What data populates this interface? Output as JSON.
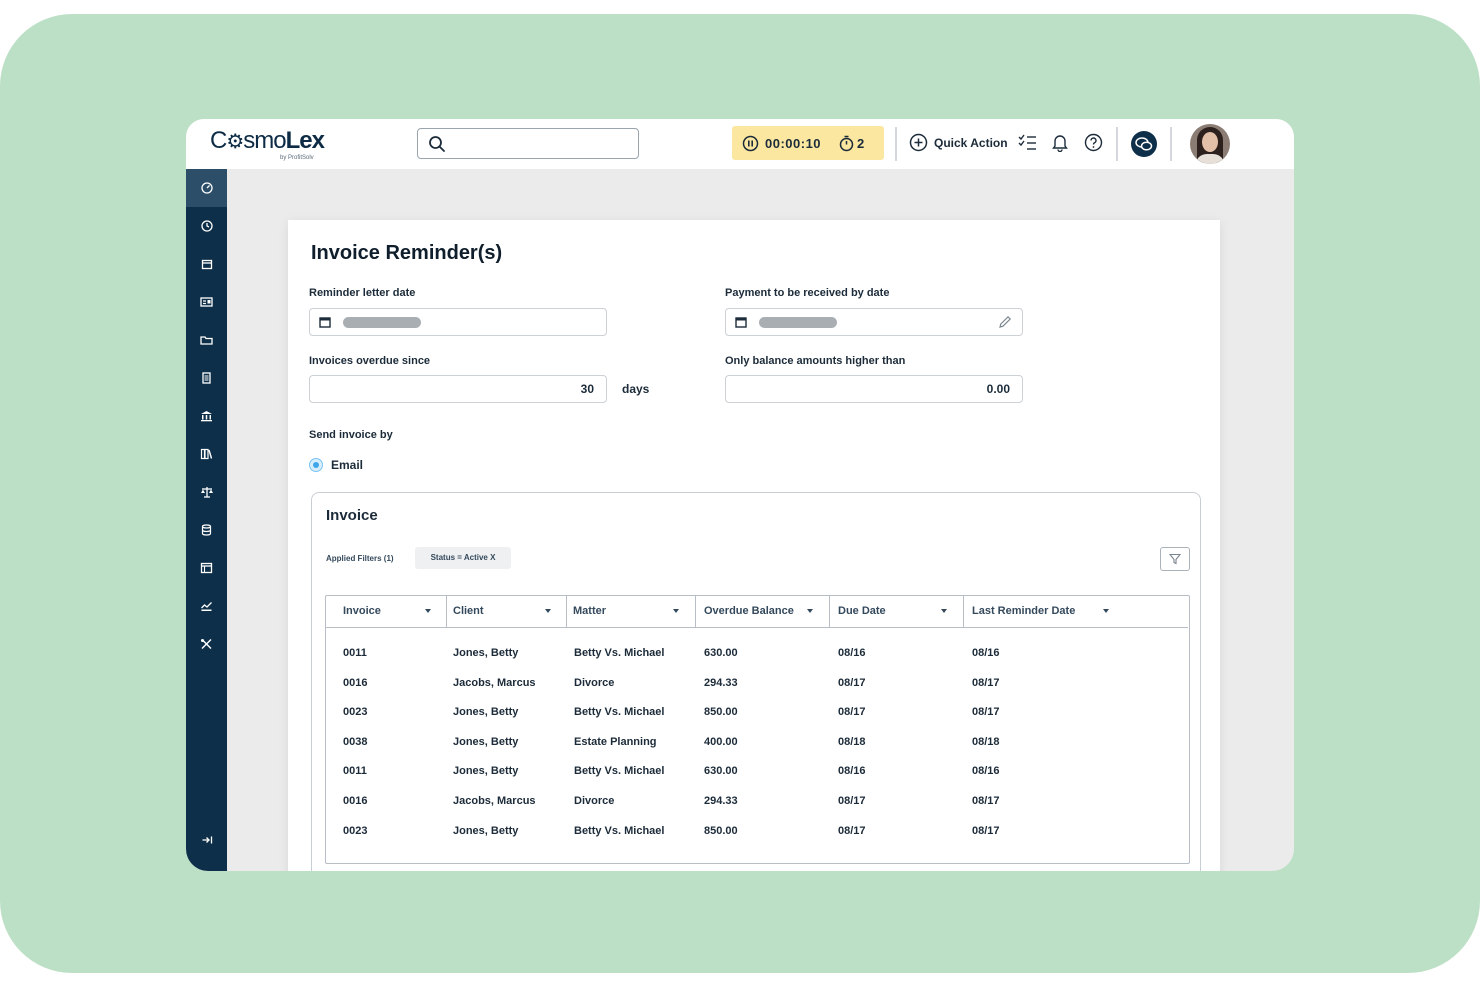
{
  "brand": {
    "name_light": "CosmoLex",
    "sub": "by ProfitSolv"
  },
  "topbar": {
    "timer_value": "00:00:10",
    "timer_count": "2",
    "quick_action_label": "Quick Action"
  },
  "page": {
    "title": "Invoice Reminder(s)"
  },
  "form": {
    "reminder_date_label": "Reminder letter date",
    "payment_date_label": "Payment to be received by date",
    "overdue_label": "Invoices overdue since",
    "overdue_value": "30",
    "overdue_unit": "days",
    "balance_label": "Only balance amounts higher than",
    "balance_value": "0.00",
    "send_by_label": "Send invoice by",
    "send_by_option": "Email"
  },
  "invoice": {
    "title": "Invoice",
    "applied_filters": "Applied Filters (1)",
    "filter_chip": "Status = Active X",
    "columns": [
      "Invoice",
      "Client",
      "Matter",
      "Overdue Balance",
      "Due Date",
      "Last Reminder Date"
    ],
    "rows": [
      [
        "0011",
        "Jones, Betty",
        "Betty Vs. Michael",
        "630.00",
        "08/16",
        "08/16"
      ],
      [
        "0016",
        "Jacobs, Marcus",
        "Divorce",
        "294.33",
        "08/17",
        "08/17"
      ],
      [
        "0023",
        "Jones, Betty",
        "Betty Vs. Michael",
        "850.00",
        "08/17",
        "08/17"
      ],
      [
        "0038",
        "Jones, Betty",
        "Estate Planning",
        "400.00",
        "08/18",
        "08/18"
      ],
      [
        "0011",
        "Jones, Betty",
        "Betty Vs. Michael",
        "630.00",
        "08/16",
        "08/16"
      ],
      [
        "0016",
        "Jacobs, Marcus",
        "Divorce",
        "294.33",
        "08/17",
        "08/17"
      ],
      [
        "0023",
        "Jones, Betty",
        "Betty Vs. Michael",
        "850.00",
        "08/17",
        "08/17"
      ]
    ]
  },
  "icons": {
    "sidebar": [
      "dashboard-icon",
      "clock-icon",
      "calendar-icon",
      "contacts-icon",
      "folder-icon",
      "document-icon",
      "bank-icon",
      "library-icon",
      "scales-icon",
      "database-icon",
      "window-icon",
      "chart-icon",
      "tools-icon",
      "collapse-icon"
    ]
  },
  "colors": {
    "sidebar": "#0e2f4a",
    "backdrop": "#bce0c5",
    "timer": "#fbe7a0",
    "accent": "#3fa6ea"
  }
}
